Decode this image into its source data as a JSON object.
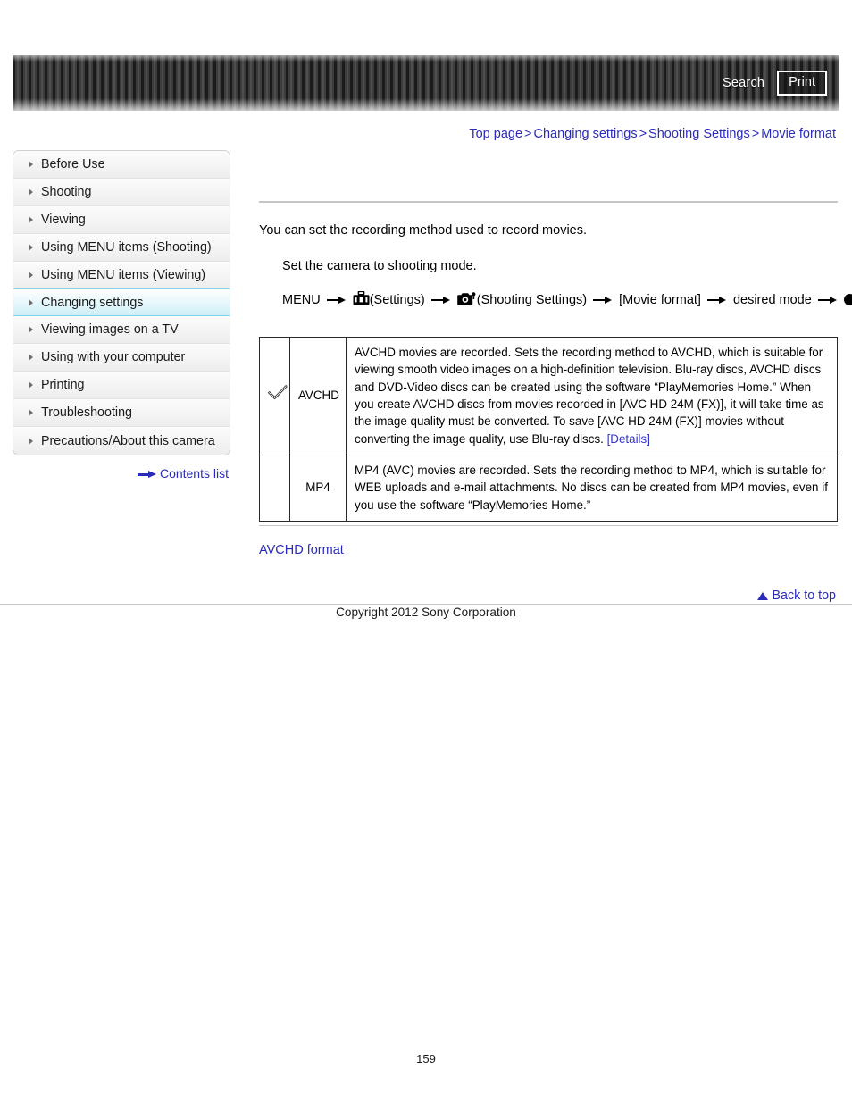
{
  "header": {
    "search_label": "Search",
    "print_label": "Print",
    "stripe_dark": "#1b1b1b",
    "stripe_light": "#4e4e4e"
  },
  "breadcrumb": {
    "separator": ">",
    "items": [
      {
        "label": "Top page"
      },
      {
        "label": "Changing settings"
      },
      {
        "label": "Shooting Settings"
      },
      {
        "label": "Movie format"
      }
    ]
  },
  "sidebar": {
    "items": [
      {
        "label": "Before Use",
        "selected": false
      },
      {
        "label": "Shooting",
        "selected": false
      },
      {
        "label": "Viewing",
        "selected": false
      },
      {
        "label": "Using MENU items (Shooting)",
        "selected": false
      },
      {
        "label": "Using MENU items (Viewing)",
        "selected": false
      },
      {
        "label": "Changing settings",
        "selected": true
      },
      {
        "label": "Viewing images on a TV",
        "selected": false
      },
      {
        "label": "Using with your computer",
        "selected": false
      },
      {
        "label": "Printing",
        "selected": false
      },
      {
        "label": "Troubleshooting",
        "selected": false
      },
      {
        "label": "Precautions/About this camera",
        "selected": false
      }
    ],
    "contents_list_label": "Contents list",
    "selected_accent": "#7fd3e8"
  },
  "main": {
    "intro": "You can set the recording method used to record movies.",
    "step": "Set the camera to shooting mode.",
    "menu_path": {
      "start": "MENU",
      "settings_label": "(Settings)",
      "shooting_settings_label": "(Shooting Settings)",
      "item": "[Movie format]",
      "mode": "desired mode"
    },
    "table": {
      "rows": [
        {
          "checked": true,
          "check_glyph": "✓",
          "label": "AVCHD",
          "description": "AVCHD movies are recorded. Sets the recording method to AVCHD, which is suitable for viewing smooth video images on a high-definition television. Blu-ray discs, AVCHD discs and DVD-Video discs can be created using the software “PlayMemories Home.” When you create AVCHD discs from movies recorded in [AVC HD 24M (FX)], it will take time as the image quality must be converted. To save [AVC HD 24M (FX)] movies without converting the image quality, use Blu-ray discs. ",
          "link_label": "[Details]"
        },
        {
          "checked": false,
          "check_glyph": "",
          "label": "MP4",
          "description": "MP4 (AVC) movies are recorded. Sets the recording method to MP4, which is suitable for WEB uploads and e-mail attachments. No discs can be created from MP4 movies, even if you use the software “PlayMemories Home.”",
          "link_label": ""
        }
      ]
    },
    "related_link_label": "AVCHD format"
  },
  "footer": {
    "back_to_top_label": "Back to top",
    "copyright": "Copyright 2012 Sony Corporation",
    "page_number": "159",
    "link_color": "#2b2bbb"
  }
}
